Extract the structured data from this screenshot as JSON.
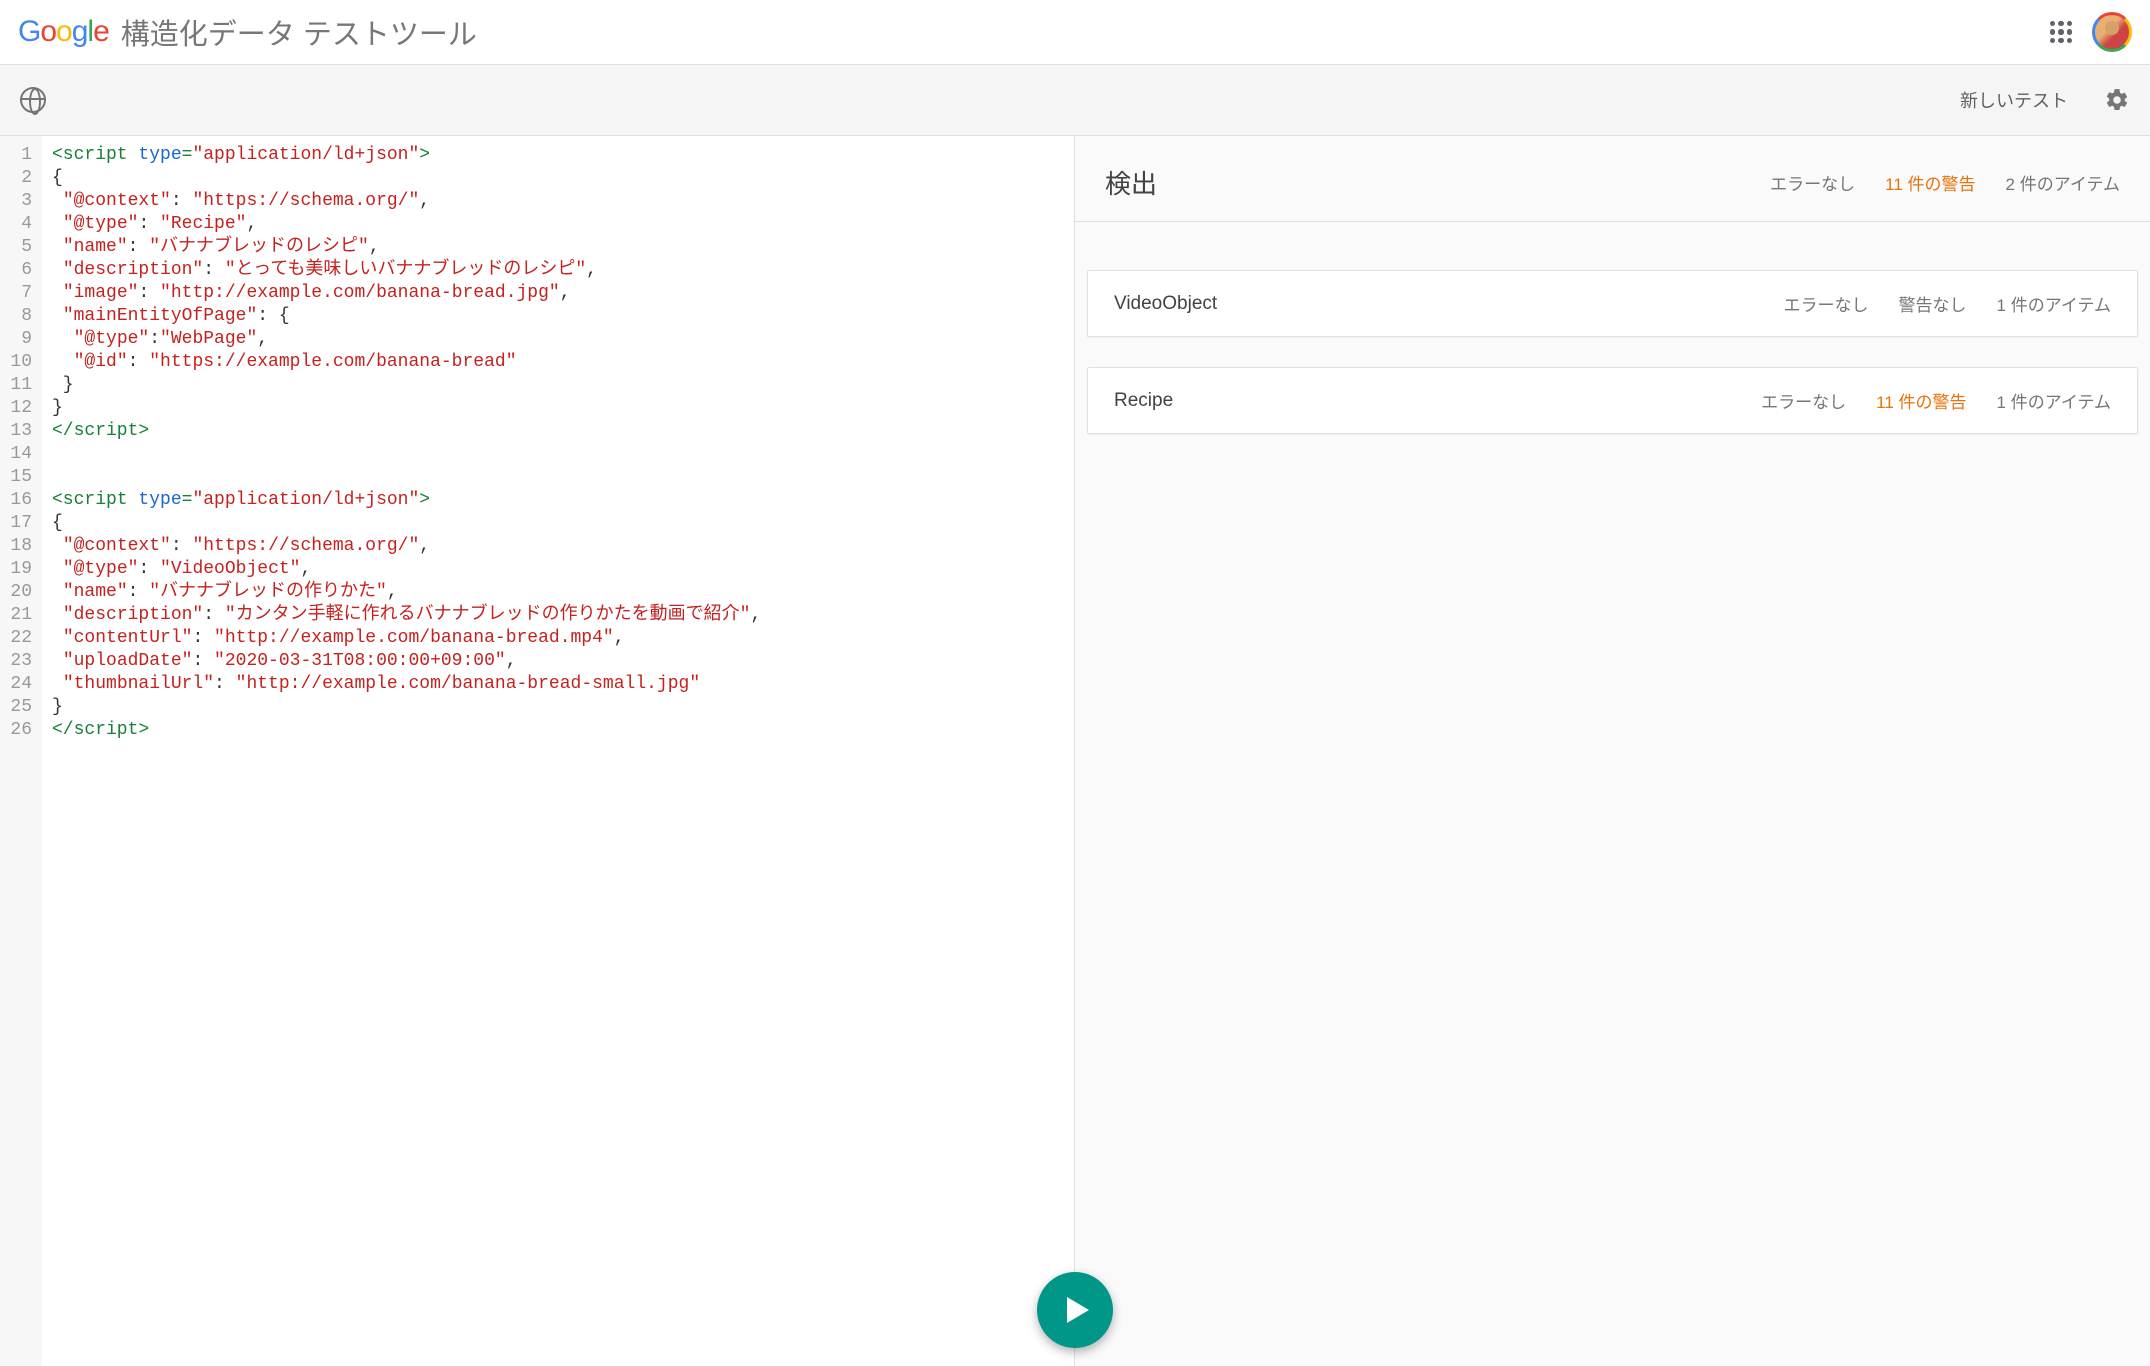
{
  "header": {
    "tool_title": "構造化データ テストツール"
  },
  "toolbar": {
    "new_test": "新しいテスト"
  },
  "editor": {
    "lines": [
      [
        [
          "tag",
          "<script "
        ],
        [
          "attr",
          "type"
        ],
        [
          "tag",
          "="
        ],
        [
          "str",
          "\"application/ld+json\""
        ],
        [
          "tag",
          ">"
        ]
      ],
      [
        [
          "",
          "{"
        ]
      ],
      [
        [
          "",
          " "
        ],
        [
          "str",
          "\"@context\""
        ],
        [
          "",
          ": "
        ],
        [
          "str",
          "\"https://schema.org/\""
        ],
        [
          "",
          ","
        ]
      ],
      [
        [
          "",
          " "
        ],
        [
          "str",
          "\"@type\""
        ],
        [
          "",
          ": "
        ],
        [
          "str",
          "\"Recipe\""
        ],
        [
          "",
          ","
        ]
      ],
      [
        [
          "",
          " "
        ],
        [
          "str",
          "\"name\""
        ],
        [
          "",
          ": "
        ],
        [
          "str",
          "\"バナナブレッドのレシピ\""
        ],
        [
          "",
          ","
        ]
      ],
      [
        [
          "",
          " "
        ],
        [
          "str",
          "\"description\""
        ],
        [
          "",
          ": "
        ],
        [
          "str",
          "\"とっても美味しいバナナブレッドのレシピ\""
        ],
        [
          "",
          ","
        ]
      ],
      [
        [
          "",
          " "
        ],
        [
          "str",
          "\"image\""
        ],
        [
          "",
          ": "
        ],
        [
          "str",
          "\"http://example.com/banana-bread.jpg\""
        ],
        [
          "",
          ","
        ]
      ],
      [
        [
          "",
          " "
        ],
        [
          "str",
          "\"mainEntityOfPage\""
        ],
        [
          "",
          ": {"
        ]
      ],
      [
        [
          "",
          "  "
        ],
        [
          "str",
          "\"@type\""
        ],
        [
          "",
          ":"
        ],
        [
          "str",
          "\"WebPage\""
        ],
        [
          "",
          ","
        ]
      ],
      [
        [
          "",
          "  "
        ],
        [
          "str",
          "\"@id\""
        ],
        [
          "",
          ": "
        ],
        [
          "str",
          "\"https://example.com/banana-bread\""
        ]
      ],
      [
        [
          "",
          " }"
        ]
      ],
      [
        [
          "",
          "}"
        ]
      ],
      [
        [
          "tag",
          "</script>"
        ]
      ],
      [
        [
          "",
          ""
        ]
      ],
      [
        [
          "",
          ""
        ]
      ],
      [
        [
          "tag",
          "<script "
        ],
        [
          "attr",
          "type"
        ],
        [
          "tag",
          "="
        ],
        [
          "str",
          "\"application/ld+json\""
        ],
        [
          "tag",
          ">"
        ]
      ],
      [
        [
          "",
          "{"
        ]
      ],
      [
        [
          "",
          " "
        ],
        [
          "str",
          "\"@context\""
        ],
        [
          "",
          ": "
        ],
        [
          "str",
          "\"https://schema.org/\""
        ],
        [
          "",
          ","
        ]
      ],
      [
        [
          "",
          " "
        ],
        [
          "str",
          "\"@type\""
        ],
        [
          "",
          ": "
        ],
        [
          "str",
          "\"VideoObject\""
        ],
        [
          "",
          ","
        ]
      ],
      [
        [
          "",
          " "
        ],
        [
          "str",
          "\"name\""
        ],
        [
          "",
          ": "
        ],
        [
          "str",
          "\"バナナブレッドの作りかた\""
        ],
        [
          "",
          ","
        ]
      ],
      [
        [
          "",
          " "
        ],
        [
          "str",
          "\"description\""
        ],
        [
          "",
          ": "
        ],
        [
          "str",
          "\"カンタン手軽に作れるバナナブレッドの作りかたを動画で紹介\""
        ],
        [
          "",
          ","
        ]
      ],
      [
        [
          "",
          " "
        ],
        [
          "str",
          "\"contentUrl\""
        ],
        [
          "",
          ": "
        ],
        [
          "str",
          "\"http://example.com/banana-bread.mp4\""
        ],
        [
          "",
          ","
        ]
      ],
      [
        [
          "",
          " "
        ],
        [
          "str",
          "\"uploadDate\""
        ],
        [
          "",
          ": "
        ],
        [
          "str",
          "\"2020-03-31T08:00:00+09:00\""
        ],
        [
          "",
          ","
        ]
      ],
      [
        [
          "",
          " "
        ],
        [
          "str",
          "\"thumbnailUrl\""
        ],
        [
          "",
          ": "
        ],
        [
          "str",
          "\"http://example.com/banana-bread-small.jpg\""
        ]
      ],
      [
        [
          "",
          "}"
        ]
      ],
      [
        [
          "tag",
          "</script>"
        ]
      ]
    ]
  },
  "results": {
    "title": "検出",
    "summary": {
      "errors": "エラーなし",
      "warnings": "11 件の警告",
      "items": "2 件のアイテム"
    },
    "cards": [
      {
        "title": "VideoObject",
        "errors": "エラーなし",
        "warnings": "警告なし",
        "warnings_warn": false,
        "items": "1 件のアイテム"
      },
      {
        "title": "Recipe",
        "errors": "エラーなし",
        "warnings": "11 件の警告",
        "warnings_warn": true,
        "items": "1 件のアイテム"
      }
    ]
  }
}
